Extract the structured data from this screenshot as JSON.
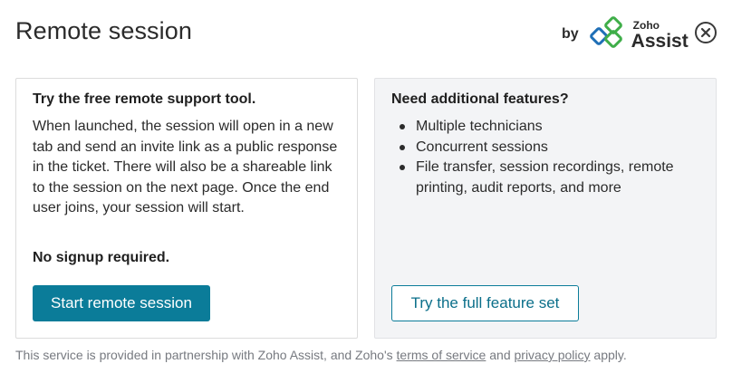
{
  "header": {
    "title": "Remote session",
    "by_label": "by",
    "brand_small": "Zoho",
    "brand_large": "Assist",
    "close_icon": "close-circle-icon"
  },
  "left_card": {
    "title": "Try the free remote support tool.",
    "body": "When launched, the session will open in a new tab and send an invite link as a public response in the ticket. There will also be a shareable link to the session on the next page. Once the end user joins, your session will start.",
    "note": "No signup required.",
    "button_label": "Start remote session"
  },
  "right_card": {
    "title": "Need additional features?",
    "features": [
      "Multiple technicians",
      "Concurrent sessions",
      "File transfer, session recordings, remote printing, audit reports, and more"
    ],
    "button_label": "Try the full feature set"
  },
  "footer": {
    "prefix": "This service is provided in partnership with Zoho Assist, and Zoho's ",
    "terms_link": "terms of service",
    "middle": " and ",
    "privacy_link": "privacy policy",
    "suffix": " apply."
  },
  "colors": {
    "primary": "#0b7c99",
    "logo_green": "#3fae49",
    "logo_blue": "#1f6fb6",
    "panel_gray": "#f3f4f6"
  }
}
